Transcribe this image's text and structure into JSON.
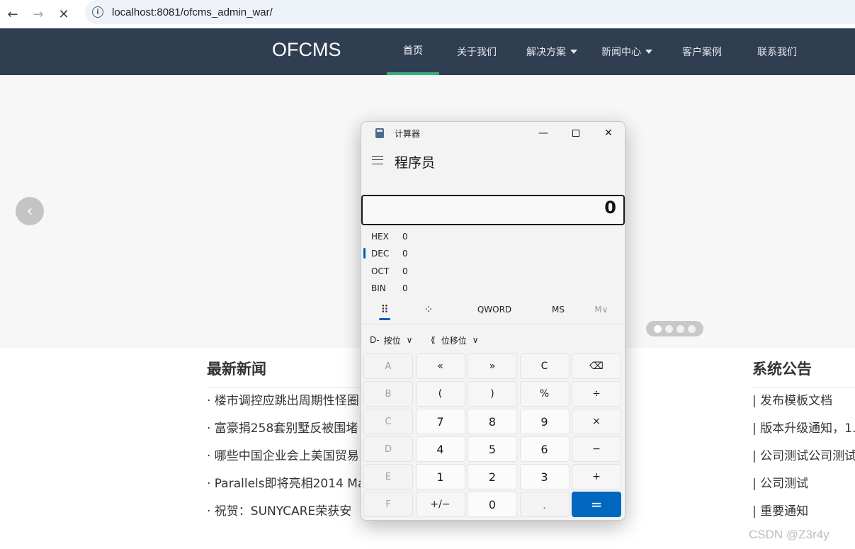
{
  "browser": {
    "back": "←",
    "forward": "→",
    "stop": "✕",
    "info_icon": "i",
    "url": "localhost:8081/ofcms_admin_war/"
  },
  "site": {
    "logo": "OFCMS",
    "menu": [
      {
        "label": "首页",
        "active": true
      },
      {
        "label": "关于我们"
      },
      {
        "label": "解决方案",
        "dropdown": true
      },
      {
        "label": "新闻中心",
        "dropdown": true
      },
      {
        "label": "客户案例"
      },
      {
        "label": "联系我们"
      }
    ],
    "carousel_prev": "‹",
    "news_title": "最新新闻",
    "news": [
      "· 楼市调控应跳出周期性怪圈",
      "· 富豪捐258套别墅反被围堵",
      "· 哪些中国企业会上美国贸易",
      "· Parallels即将亮相2014 Ma",
      "· 祝贺：SUNYCARE荣获安"
    ],
    "notice_title": "系统公告",
    "notices": [
      "| 发布模板文档",
      "| 版本升级通知，1.",
      "| 公司测试公司测试",
      "| 公司测试",
      "| 重要通知"
    ],
    "watermark": "CSDN @Z3r4y"
  },
  "calculator": {
    "title": "计算器",
    "minimize": "—",
    "close": "✕",
    "menu_icon": "hamburger-menu-icon",
    "mode": "程序员",
    "display": "0",
    "radix": [
      {
        "label": "HEX",
        "value": "0"
      },
      {
        "label": "DEC",
        "value": "0",
        "selected": true
      },
      {
        "label": "OCT",
        "value": "0"
      },
      {
        "label": "BIN",
        "value": "0"
      }
    ],
    "keypad_icon": "⠿",
    "bit_toggle_icon": "⁘",
    "word_size": "QWORD",
    "ms": "MS",
    "m_list": "M∨",
    "bitwise": "按位",
    "bitshift": "位移位",
    "bitwise_icon": "D-",
    "bitshift_icon": "⟪",
    "chevron": "∨",
    "keys": [
      "A",
      "«",
      "»",
      "C",
      "⌫",
      "B",
      "(",
      ")",
      "%",
      "÷",
      "C",
      "7",
      "8",
      "9",
      "×",
      "D",
      "4",
      "5",
      "6",
      "−",
      "E",
      "1",
      "2",
      "3",
      "+",
      "F",
      "+/−",
      "0",
      ".",
      "="
    ]
  }
}
